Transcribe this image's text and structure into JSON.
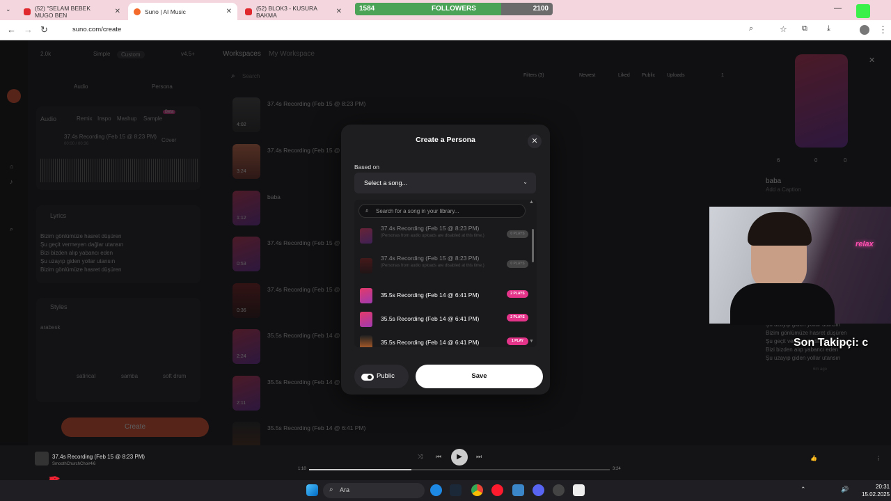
{
  "browser": {
    "tabs": [
      {
        "label": "(52) \"SELAM BEBEK MUGO BEN",
        "active": false
      },
      {
        "label": "Suno | AI Music",
        "active": true
      },
      {
        "label": "(52) BLOK3 - KUSURA BAKMA",
        "active": false
      }
    ],
    "url": "suno.com/create"
  },
  "followers": {
    "current": "1584",
    "label": "FOLLOWERS",
    "goal": "2100",
    "progress": 0.74
  },
  "left_panel": {
    "credits": "2.0k",
    "modes": [
      "Simple",
      "Custom"
    ],
    "version": "v4.5+",
    "add_audio": "Audio",
    "add_persona": "Persona",
    "audio_label": "Audio",
    "audio_tabs": [
      "Remix",
      "Inspo",
      "Mashup",
      "Sample"
    ],
    "beta": "Beta",
    "clip_title": "37.4s Recording (Feb 15 @ 8:23 PM)",
    "clip_time": "00:00 / 00:36",
    "clip_mode": "Cover",
    "lyrics_label": "Lyrics",
    "lyrics": [
      "Bizim gönlümüze hasret düşüren",
      "Şu geçit vermeyen dağlar utansın",
      "Bizi bizden alıp yabancı eden",
      "Şu uzayıp giden yollar utansın",
      "Bizim gönlümüze hasret düşüren"
    ],
    "styles_label": "Styles",
    "styles_value": "arabesk",
    "style_tags": [
      "satirical",
      "samba",
      "soft drum"
    ],
    "create": "Create"
  },
  "main": {
    "breadcrumb_root": "Workspaces",
    "breadcrumb_current": "My Workspace",
    "search_placeholder": "Search",
    "filters": "Filters (3)",
    "sort": "Newest",
    "chips": [
      "Liked",
      "Public",
      "Uploads"
    ],
    "page": "1",
    "rows": [
      {
        "title": "37.4s Recording (Feb 15 @ 8:23 PM)",
        "duration": "4:02"
      },
      {
        "title": "37.4s Recording (Feb 15 @ 8:2",
        "duration": "3:24"
      },
      {
        "title": "baba",
        "duration": "1:12"
      },
      {
        "title": "37.4s Recording (Feb 15 @ 8:2",
        "duration": "0:53"
      },
      {
        "title": "37.4s Recording (Feb 15 @ 8:2",
        "duration": "0:36"
      },
      {
        "title": "35.5s Recording (Feb 14 @ 6:",
        "duration": "2:24"
      },
      {
        "title": "35.5s Recording (Feb 14 @ 6:",
        "duration": "2:11"
      },
      {
        "title": "35.5s Recording (Feb 14 @ 6:41 PM)",
        "duration": ""
      }
    ]
  },
  "right_panel": {
    "plays": "6",
    "likes": "0",
    "comments": "0",
    "title": "baba",
    "caption": "Add a Caption",
    "lyrics": [
      "Şu uzayıp giden yollar utansın",
      "Bizim gönlümüze hasret düşüren",
      "Şu geçit vermeyen dağlar utansın",
      "Bizi bizden alıp yabancı eden",
      "Şu uzayıp giden yollar utansın"
    ],
    "time_ago": "6m ago"
  },
  "modal": {
    "title": "Create a Persona",
    "based_on": "Based on",
    "select_placeholder": "Select a song...",
    "search_placeholder": "Search for a song in your library...",
    "songs": [
      {
        "title": "37.4s Recording (Feb 15 @ 8:23 PM)",
        "note": "(Personas from audio uploads are disabled at this time.)",
        "plays": "0 PLAYS",
        "disabled": true
      },
      {
        "title": "37.4s Recording (Feb 15 @ 8:23 PM)",
        "note": "(Personas from audio uploads are disabled at this time.)",
        "plays": "0 PLAYS",
        "disabled": true
      },
      {
        "title": "35.5s Recording (Feb 14 @ 6:41 PM)",
        "note": "",
        "plays": "2 PLAYS",
        "disabled": false
      },
      {
        "title": "35.5s Recording (Feb 14 @ 6:41 PM)",
        "note": "",
        "plays": "2 PLAYS",
        "disabled": false
      },
      {
        "title": "35.5s Recording (Feb 14 @ 6:41 PM)",
        "note": "",
        "plays": "1 PLAY",
        "disabled": false
      }
    ],
    "public_label": "Public",
    "save_label": "Save"
  },
  "overlay": {
    "webcam_neon": "relax",
    "ticker": "Son Takipçi: c"
  },
  "player": {
    "title": "37.4s Recording (Feb 15 @ 8:23 PM)",
    "artist": "SmoothChurchChoir4i6",
    "elapsed": "1:10",
    "total": "3:24",
    "progress": 0.34
  },
  "taskbar": {
    "search": "Ara",
    "time": "20:31",
    "date": "15.02.2025"
  },
  "colors": {
    "accent": "#e3348a",
    "create": "#e8502a",
    "followers_fill": "#4aa356"
  }
}
